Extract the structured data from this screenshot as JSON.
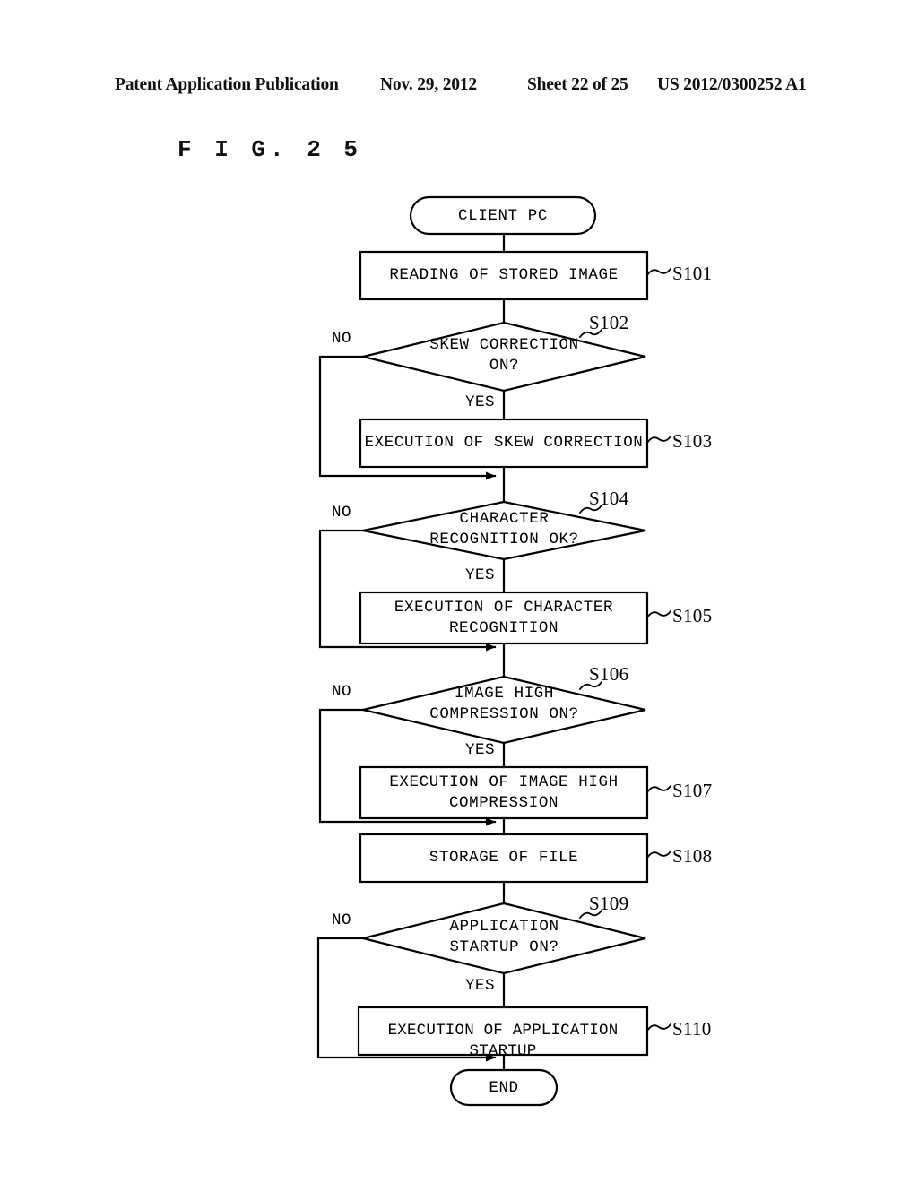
{
  "header": {
    "publication": "Patent Application Publication",
    "date": "Nov. 29, 2012",
    "sheet": "Sheet 22 of 25",
    "number": "US 2012/0300252 A1"
  },
  "figure": {
    "label": "F I G. 2 5"
  },
  "flowchart": {
    "start_terminal": "CLIENT PC",
    "end_terminal": "END",
    "yes_label": "YES",
    "no_label": "NO",
    "nodes": [
      {
        "id": "S101",
        "shape": "process",
        "text": "READING OF STORED IMAGE",
        "step": "S101"
      },
      {
        "id": "S102",
        "shape": "decision",
        "text": "SKEW CORRECTION\nON?",
        "step": "S102"
      },
      {
        "id": "S103",
        "shape": "process",
        "text": "EXECUTION OF SKEW CORRECTION",
        "step": "S103"
      },
      {
        "id": "S104",
        "shape": "decision",
        "text": "CHARACTER\nRECOGNITION OK?",
        "step": "S104"
      },
      {
        "id": "S105",
        "shape": "process",
        "text": "EXECUTION OF CHARACTER\nRECOGNITION",
        "step": "S105"
      },
      {
        "id": "S106",
        "shape": "decision",
        "text": "IMAGE HIGH\nCOMPRESSION ON?",
        "step": "S106"
      },
      {
        "id": "S107",
        "shape": "process",
        "text": "EXECUTION OF IMAGE HIGH\nCOMPRESSION",
        "step": "S107"
      },
      {
        "id": "S108",
        "shape": "process",
        "text": "STORAGE OF FILE",
        "step": "S108"
      },
      {
        "id": "S109",
        "shape": "decision",
        "text": "APPLICATION\nSTARTUP ON?",
        "step": "S109"
      },
      {
        "id": "S110",
        "shape": "process",
        "text": "EXECUTION OF APPLICATION STARTUP",
        "step": "S110"
      }
    ]
  },
  "colors": {
    "ink": "#000000",
    "paper": "#ffffff"
  }
}
